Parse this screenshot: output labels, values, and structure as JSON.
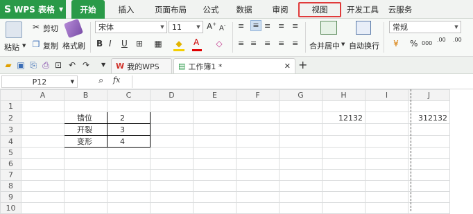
{
  "app": {
    "logo_text": "WPS 表格",
    "logo_glyph": "S"
  },
  "menu": {
    "tabs": [
      {
        "label": "开始",
        "active": true
      },
      {
        "label": "插入"
      },
      {
        "label": "页面布局"
      },
      {
        "label": "公式"
      },
      {
        "label": "数据"
      },
      {
        "label": "审阅"
      },
      {
        "label": "视图",
        "highlighted": true
      },
      {
        "label": "开发工具"
      },
      {
        "label": "云服务"
      }
    ]
  },
  "ribbon": {
    "paste_label": "粘贴",
    "cut_label": "剪切",
    "copy_label": "复制",
    "format_painter_label": "格式刷",
    "font_name": "宋体",
    "font_size": "11",
    "bold": "B",
    "italic": "I",
    "underline": "U",
    "merge_label": "合并居中",
    "wrap_label": "自动换行",
    "number_format": "常规",
    "percent": "%",
    "thousand": "000",
    "inc_decimal": ".00",
    "dec_decimal": ".00"
  },
  "quick_access": {
    "tabs": [
      {
        "label": "我的WPS"
      },
      {
        "label": "工作簿1 *"
      }
    ]
  },
  "formula_bar": {
    "cell_ref": "P12",
    "fx_label": "fx",
    "formula": ""
  },
  "sheet": {
    "columns": [
      "A",
      "B",
      "C",
      "D",
      "E",
      "F",
      "G",
      "H",
      "I",
      "J"
    ],
    "rows": [
      "1",
      "2",
      "3",
      "4",
      "5",
      "6",
      "7",
      "8",
      "9",
      "10"
    ],
    "cells": {
      "B2": "错位",
      "C2": "2",
      "H2": "12132",
      "J2": "312132",
      "B3": "开裂",
      "C3": "3",
      "B4": "变形",
      "C4": "4"
    }
  },
  "colors": {
    "accent": "#2a9a48",
    "highlight_box": "#e03b3b"
  }
}
